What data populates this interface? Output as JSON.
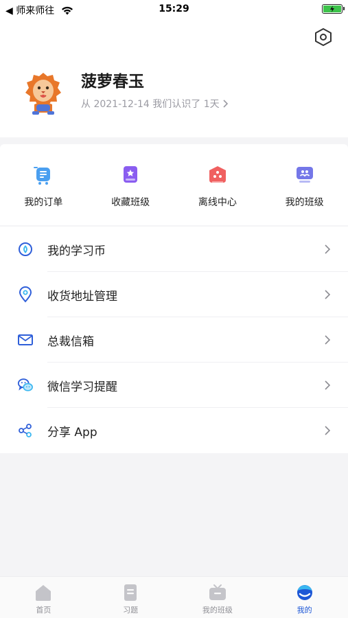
{
  "status_bar": {
    "carrier": "◀ 师来师往",
    "time": "15:29"
  },
  "profile": {
    "name": "菠萝春玉",
    "join_text": "从 2021-12-14 我们认识了 1天",
    "settings_icon": "settings-hexagon-icon",
    "avatar_icon": "lion-avatar-icon"
  },
  "quick_actions": [
    {
      "label": "我的订单",
      "icon": "order-cart-icon",
      "color": "#4a9ff0"
    },
    {
      "label": "收藏班级",
      "icon": "bookmark-star-icon",
      "color": "#8a5df0"
    },
    {
      "label": "离线中心",
      "icon": "offline-box-icon",
      "color": "#f06060"
    },
    {
      "label": "我的班级",
      "icon": "class-screen-icon",
      "color": "#7477e8"
    }
  ],
  "menu": [
    {
      "label": "我的学习币",
      "icon": "coin-icon"
    },
    {
      "label": "收货地址管理",
      "icon": "location-pin-icon"
    },
    {
      "label": "总裁信箱",
      "icon": "mail-icon"
    },
    {
      "label": "微信学习提醒",
      "icon": "wechat-icon"
    },
    {
      "label": "分享 App",
      "icon": "share-icon"
    }
  ],
  "tabs": [
    {
      "label": "首页",
      "icon": "home-icon",
      "active": false
    },
    {
      "label": "习题",
      "icon": "exercise-icon",
      "active": false
    },
    {
      "label": "我的班级",
      "icon": "tv-class-icon",
      "active": false
    },
    {
      "label": "我的",
      "icon": "me-icon",
      "active": true
    }
  ],
  "colors": {
    "accent": "#1d57d6",
    "inactive": "#8f8f95"
  }
}
